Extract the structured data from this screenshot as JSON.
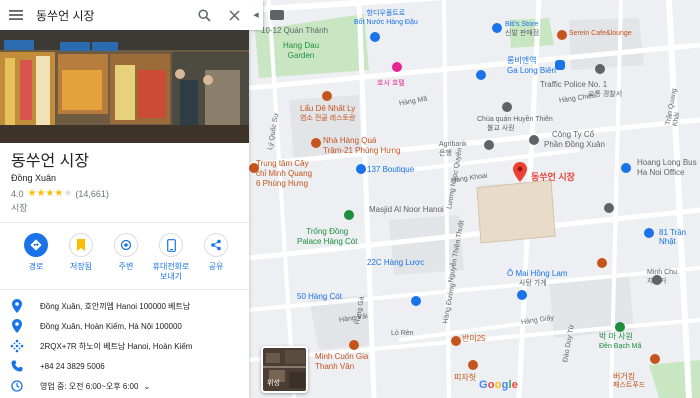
{
  "search": {
    "query": "동쑤언 시장"
  },
  "place": {
    "title": "동쑤언 시장",
    "subtitle": "Đồng Xuân",
    "rating": "4.0",
    "stars": 4,
    "review_count": "(14,661)",
    "category": "시장"
  },
  "actions": [
    {
      "label": "경로",
      "icon": "directions-icon"
    },
    {
      "label": "저장됨",
      "icon": "bookmark-icon"
    },
    {
      "label": "주변",
      "icon": "nearby-icon"
    },
    {
      "label": "휴대전화로\n보내기",
      "line1": "휴대전화로",
      "line2": "보내기",
      "icon": "phone-send-icon"
    },
    {
      "label": "공유",
      "icon": "share-icon"
    }
  ],
  "details": {
    "address_local": "Đồng Xuân, 호안끼엠 Hanoi 100000 베트남",
    "address": "Đồng Xuân, Hoàn Kiếm, Hà Nội 100000",
    "plus_code": "2RQX+7R 하노이 베트남 Hanoi, Hoàn Kiếm",
    "phone": "+84 24 3829 5006",
    "hours": "영업 중:  오전 6:00~오후 6:00"
  },
  "map": {
    "satellite_label": "위성",
    "google_logo": "Google",
    "marker_label": "동쑤언 시장",
    "labels": {
      "quan_thanh": "10-12 Quán Thánh",
      "hang_dau_1": "Hang Dau",
      "hang_dau_2": "Garden",
      "hangcuu_1": "항디우풀트로",
      "hangcuu_2": "Bốt Nước Hàng Đậu",
      "bitis_1": "Biti's Store",
      "bitis_2": "신발 판매점",
      "serein": "Serein Cafe&lounge",
      "longbien_1": "롱비엔역",
      "longbien_2": "Ga Long Biên",
      "traffic_police": "Traffic Police No. 1",
      "traffic_police_sub": "교통 경찰서",
      "hotel": "호시 호텔",
      "lau_de_1": "Lẩu Dê Nhất Ly",
      "lau_de_2": "염소 전골 레스토랑",
      "chua_1": "Chùa quán Huyền Thiên",
      "chua_2": "불교 사원",
      "nha_hang_1": "Nhà Hàng Quá",
      "nha_hang_2": "Trâm-21 Phùng Hưng",
      "agribank": "Agribank",
      "agribank_sub": "은행",
      "cong_ty_1": "Công Ty Cổ",
      "cong_ty_2": "Phần Đồng Xuân",
      "hoang_long_1": "Hoang Long Bus",
      "hoang_long_2": "Ha Noi Office",
      "trung_tam_1": "Trung tâm Cây",
      "trung_tam_2": "chỉ Minh Quang",
      "trung_tam_3": "6 Phùng Hưng",
      "boutique": "137 Boutique",
      "masjid": "Masjid Al Noor Hanoi",
      "trong_dong_1": "Trống Đồng",
      "trong_dong_2": "Palace Hàng Cót",
      "tran_nhat_duat": "81 Trần Nhật",
      "hang_luoc": "22C Hàng Lược",
      "o_mai_1": "Ô Mai Hồng Lam",
      "o_mai_2": "사탕 가게",
      "hang_cot": "50 Hàng Cót",
      "minh_chu_1": "Minh Chu",
      "minh_chu_2": "자전거",
      "bac_ma_1": "박 마 사원",
      "bac_ma_2": "Đền Bạch Mã",
      "banmi": "반미25",
      "cuon_gia_1": "Minh Cuốn Gia",
      "cuon_gia_2": "Thanh Vân",
      "burger": "버거킹",
      "fast_food": "패스트푸드",
      "pizza": "피자헛",
      "hang_khoai": "Hàng Khoai",
      "ly_quoc_su": "Lý Quốc Sư",
      "hang_ga": "Hàng Gà",
      "hang_chieu": "Hàng Chiếu",
      "hang_ma": "Hàng Mã",
      "lo_ren": "Lò Rèn",
      "hang_duong": "Hàng Đường",
      "hang_giay": "Hàng Giấy",
      "nguyen_thien_thuat": "Nguyễn Thiện Thuật",
      "tran_quang_khai": "Trần Quang Khải",
      "hang_vai": "Hàng Vải",
      "luong_ngoc_quyen": "Lương Ngọc Quyến",
      "dao_duy_tu": "Đào Duy Từ"
    }
  },
  "colors": {
    "accent": "#1a73e8",
    "marker": "#ea4335",
    "map_bg": "#eef0f3",
    "park": "#c9e6c3",
    "road": "#ffffff",
    "text_orange": "#c5541d",
    "text_blue": "#1a73e8",
    "text_green": "#1e8e3e",
    "star": "#fbbc04"
  }
}
